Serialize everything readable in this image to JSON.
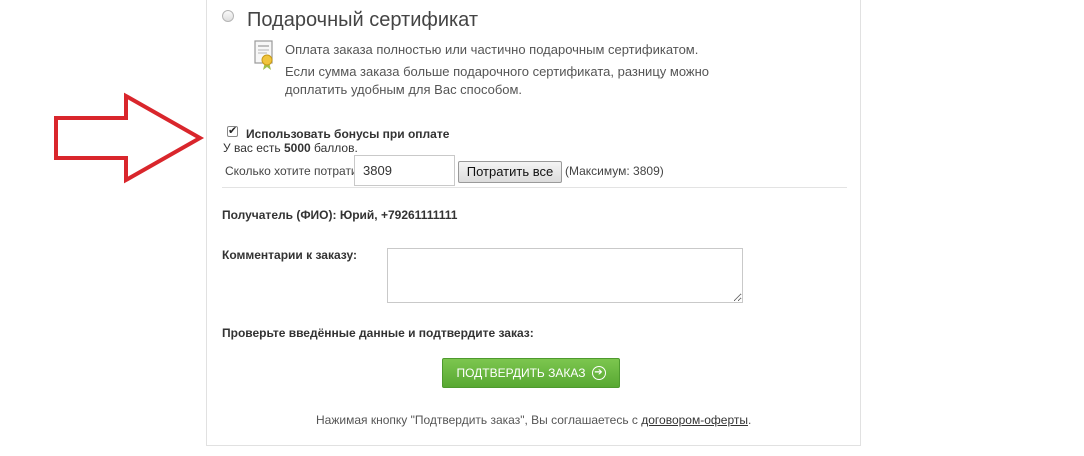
{
  "certificate": {
    "title": "Подарочный сертификат",
    "line1": "Оплата заказа полностью или частично подарочным сертификатом.",
    "line2": "Если сумма заказа больше подарочного сертификата, разницу можно",
    "line3": "доплатить удобным для Вас способом."
  },
  "bonus": {
    "checkbox_label": "Использовать бонусы при оплате",
    "have_prefix": "У вас есть ",
    "points": "5000",
    "have_suffix": " баллов.",
    "spend_label": "Сколько хотите потратить?",
    "amount_value": "3809",
    "spend_all_label": "Потратить все",
    "max_note": "(Максимум: 3809)"
  },
  "recipient": "Получатель (ФИО): Юрий, +79261111111",
  "comment_label": "Комментарии к заказу:",
  "confirm_hint": "Проверьте введённые данные и подтвердите заказ:",
  "confirm_button": "ПОДТВЕРДИТЬ ЗАКАЗ",
  "agreement": {
    "prefix": "Нажимая кнопку \"Подтвердить заказ\", Вы соглашаетесь с ",
    "link": "договором-оферты",
    "suffix": "."
  },
  "colors": {
    "arrow": "#d9262c",
    "confirm_button": "#6cb842"
  }
}
